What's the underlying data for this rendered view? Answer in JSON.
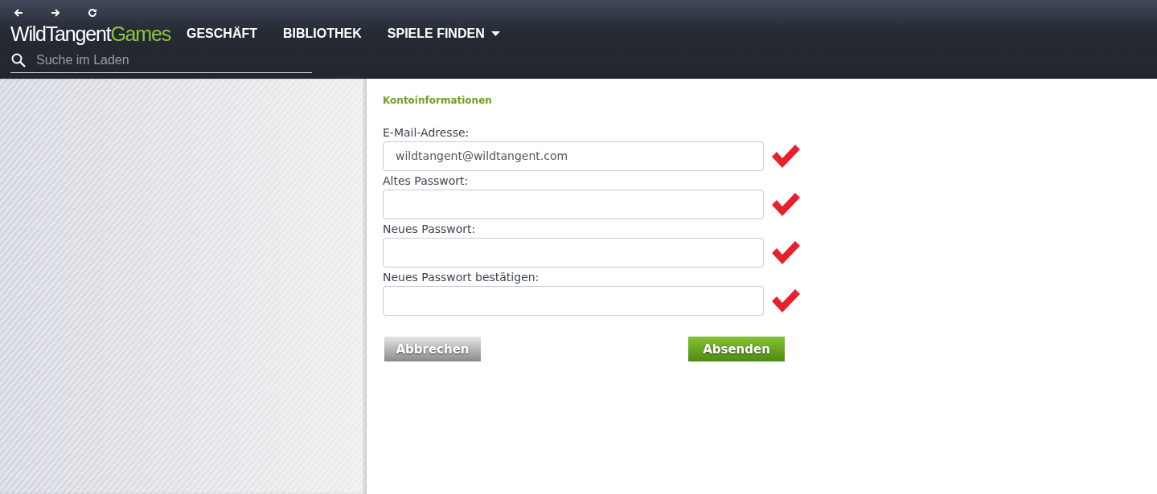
{
  "header": {
    "nav_buttons": [
      {
        "kind": "back"
      },
      {
        "kind": "forward"
      },
      {
        "kind": "reload"
      }
    ],
    "logo": {
      "brand": "WildTangent",
      "suffix": "Games"
    },
    "menu": [
      {
        "label": "GESCHÄFT",
        "dropdown": false
      },
      {
        "label": "BIBLIOTHEK",
        "dropdown": false
      },
      {
        "label": "SPIELE FINDEN",
        "dropdown": true
      }
    ],
    "search": {
      "placeholder": "Suche im Laden"
    }
  },
  "form": {
    "title": "Kontoinformationen",
    "fields": [
      {
        "label": "E-Mail-Adresse:",
        "value": "wildtangent@wildtangent.com",
        "valid": true
      },
      {
        "label": "Altes Passwort:",
        "valid": true
      },
      {
        "label": "Neues Passwort:",
        "valid": true
      },
      {
        "label": "Neues Passwort bestätigen:",
        "valid": true
      }
    ],
    "buttons": [
      {
        "label": "Abbrechen",
        "kind": "secondary"
      },
      {
        "label": "Absenden",
        "kind": "primary"
      }
    ]
  }
}
